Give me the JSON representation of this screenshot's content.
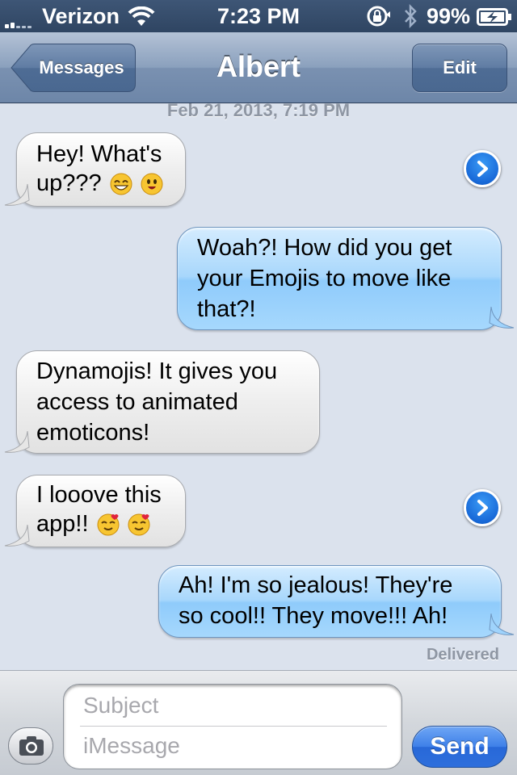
{
  "status_bar": {
    "carrier": "Verizon",
    "time": "7:23 PM",
    "battery_percent": "99%",
    "signal_bars": 2,
    "icons": [
      "signal-icon",
      "wifi-icon",
      "rotation-lock-icon",
      "bluetooth-icon",
      "battery-charging-icon"
    ]
  },
  "nav": {
    "back_label": "Messages",
    "title": "Albert",
    "edit_label": "Edit"
  },
  "conversation": {
    "timestamp": "Feb 21, 2013, 7:19 PM",
    "messages": [
      {
        "direction": "incoming",
        "lines": [
          "Hey! What's",
          "up???"
        ],
        "emoji": [
          "grinning-face-icon",
          "surprised-face-icon"
        ],
        "has_disclosure": true
      },
      {
        "direction": "outgoing",
        "lines": [
          "Woah?! How did you get",
          "your Emojis to move like",
          "that?!"
        ]
      },
      {
        "direction": "incoming",
        "lines": [
          "Dynamojis! It gives you",
          "access to animated",
          "emoticons!"
        ]
      },
      {
        "direction": "incoming",
        "lines": [
          "I looove this",
          "app!!"
        ],
        "emoji": [
          "heart-kiss-face-icon",
          "heart-kiss-face-icon"
        ],
        "has_disclosure": true
      },
      {
        "direction": "outgoing",
        "lines": [
          "Ah! I'm so jealous! They're",
          "so cool!! They move!!! Ah!"
        ]
      }
    ],
    "delivered_label": "Delivered"
  },
  "compose": {
    "subject_placeholder": "Subject",
    "message_placeholder": "iMessage",
    "send_label": "Send"
  },
  "colors": {
    "background": "#dbe2ed",
    "outgoing_bubble": "#a8d7fc",
    "incoming_bubble": "#eeeeee",
    "send_button": "#3e80e8",
    "nav_bar": "#7a91b1"
  }
}
